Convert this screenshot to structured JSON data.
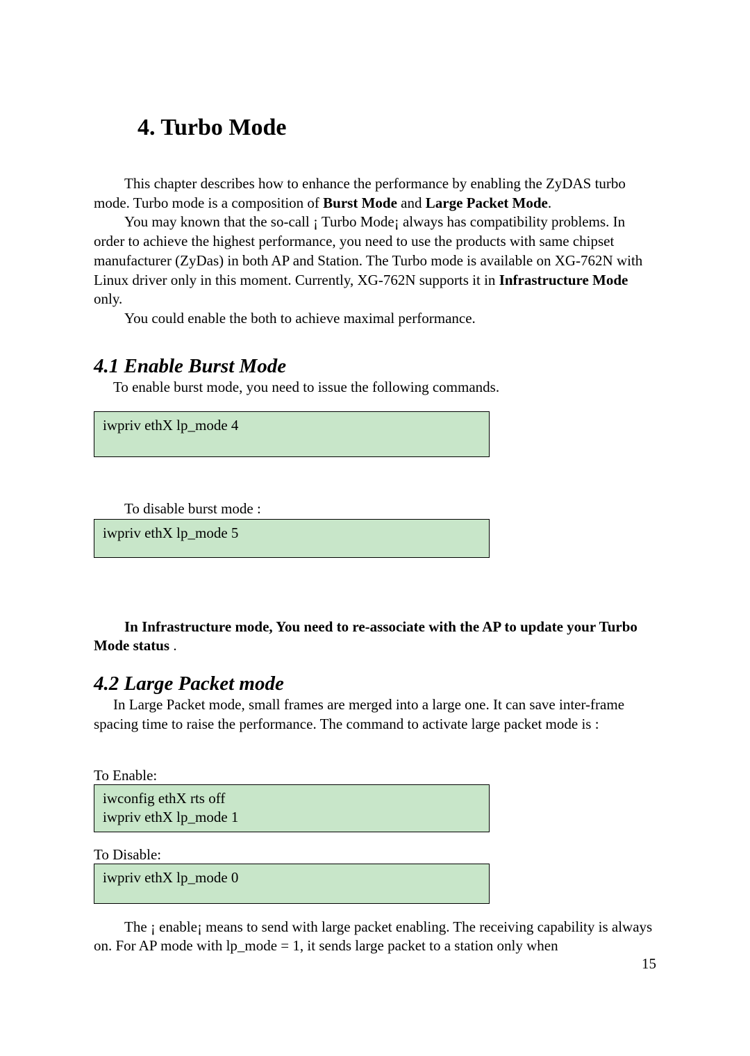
{
  "chapter": {
    "title": "4. Turbo Mode"
  },
  "intro": {
    "p1_prefix": "This chapter describes how to enhance the performance by enabling the ZyDAS turbo mode. Turbo mode is a composition of ",
    "p1_b1": "Burst Mode",
    "p1_mid": " and ",
    "p1_b2": "Large Packet Mode",
    "p1_suffix": ".",
    "p2_a": "You may known that the so-call ¡ Turbo Mode¡  always has compatibility problems. In order to achieve the highest performance, you need to use the products with same chipset manufacturer (ZyDas) in both AP and Station. The Turbo mode is available on XG-762N with Linux driver only in this moment. Currently, XG-762N supports it in ",
    "p2_b": "Infrastructure Mode",
    "p2_c": " only.",
    "p3": "You could enable the both to achieve maximal performance."
  },
  "s41": {
    "heading": "4.1 Enable Burst Mode",
    "p1": "To enable burst mode, you need to issue the following commands.",
    "cmd_enable": "iwpriv ethX lp_mode 4",
    "p2": "To disable burst mode :",
    "cmd_disable": "iwpriv ethX lp_mode 5",
    "note_a": "In Infrastructure mode, You need to re-associate with the AP to update your Turbo Mode status",
    "note_b": " ."
  },
  "s42": {
    "heading": "4.2 Large Packet mode",
    "p1": "In Large Packet mode, small frames are merged into a large one. It can save inter-frame spacing time to raise the performance. The command to activate large packet mode is :",
    "label_enable": "To Enable:",
    "cmd_enable_l1": "iwconfig ethX rts off",
    "cmd_enable_l2": "iwpriv ethX lp_mode 1",
    "label_disable": "To Disable:",
    "cmd_disable": "iwpriv ethX lp_mode 0",
    "p2": "The ¡ enable¡  means to send with large packet enabling. The receiving capability is always on. For AP mode with lp_mode = 1, it sends large packet to a station only when"
  },
  "page_number": "15"
}
